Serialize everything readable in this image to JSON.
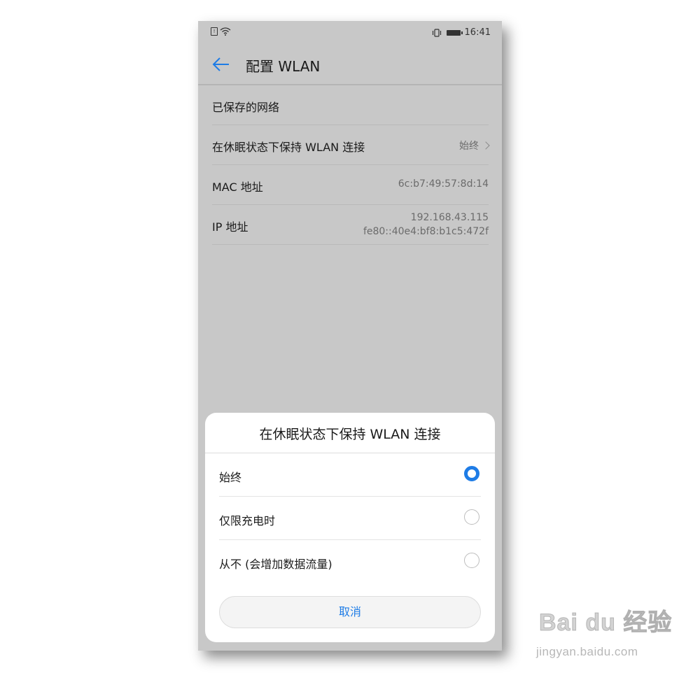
{
  "status_bar": {
    "time": "16:41",
    "icons": [
      "sim-icon",
      "wifi-icon",
      "vibrate-icon",
      "battery-icon"
    ]
  },
  "app_bar": {
    "back_icon": "arrow-left-icon",
    "title": "配置 WLAN"
  },
  "settings": {
    "saved_networks": "已保存的网络",
    "keep_wlan_label": "在休眠状态下保持 WLAN 连接",
    "keep_wlan_value": "始终",
    "mac_label": "MAC 地址",
    "mac_value": "6c:b7:49:57:8d:14",
    "ip_label": "IP 地址",
    "ip_v4": "192.168.43.115",
    "ip_v6": "fe80::40e4:bf8:b1c5:472f"
  },
  "dialog": {
    "title": "在休眠状态下保持 WLAN 连接",
    "options": [
      {
        "label": "始终",
        "selected": true
      },
      {
        "label": "仅限充电时",
        "selected": false
      },
      {
        "label": "从不 (会增加数据流量)",
        "selected": false
      }
    ],
    "cancel_label": "取消"
  },
  "colors": {
    "accent": "#1e7ce6",
    "dimmed_background": "#c8c8c8",
    "dialog_background": "#ffffff"
  },
  "watermark": {
    "brand_text": "Bai du 经验",
    "url": "jingyan.baidu.com"
  }
}
